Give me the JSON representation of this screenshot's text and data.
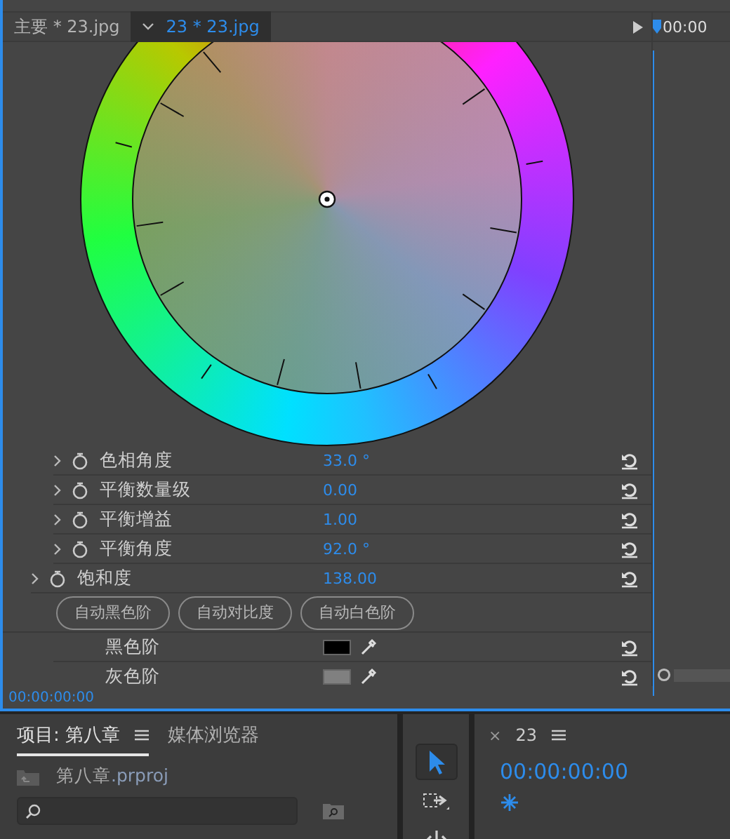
{
  "effect_controls": {
    "tabs": [
      {
        "label": "主要 * 23.jpg",
        "selected": false
      },
      {
        "label": "23 * 23.jpg",
        "selected": true
      }
    ],
    "timeline_timecode": "00:00",
    "params": [
      {
        "kind": "sub_param",
        "label": "色相角度",
        "value": "33.0 °"
      },
      {
        "kind": "sub_param",
        "label": "平衡数量级",
        "value": "0.00"
      },
      {
        "kind": "sub_param",
        "label": "平衡增益",
        "value": "1.00"
      },
      {
        "kind": "sub_param",
        "label": "平衡角度",
        "value": "92.0 °"
      },
      {
        "kind": "param",
        "label": "饱和度",
        "value": "138.00"
      },
      {
        "kind": "buttons",
        "buttons": [
          "自动黑色阶",
          "自动对比度",
          "自动白色阶"
        ]
      },
      {
        "kind": "color",
        "label": "黑色阶",
        "color": "#000000"
      },
      {
        "kind": "color",
        "label": "灰色阶",
        "color": "#808080"
      }
    ],
    "timecode": "00:00:00:00"
  },
  "project": {
    "tabs": [
      {
        "label": "项目: 第八章",
        "selected": true,
        "menu": true
      },
      {
        "label": "媒体浏览器",
        "selected": false,
        "menu": false
      }
    ],
    "file": {
      "name": "第八章",
      "extension": ".prproj"
    }
  },
  "tools": [
    {
      "kind": "selection",
      "selected": true
    },
    {
      "kind": "track_select",
      "selected": false
    },
    {
      "kind": "ripple",
      "selected": false
    }
  ],
  "sequence": {
    "close": "×",
    "title": "23",
    "timecode": "00:00:00:00"
  }
}
